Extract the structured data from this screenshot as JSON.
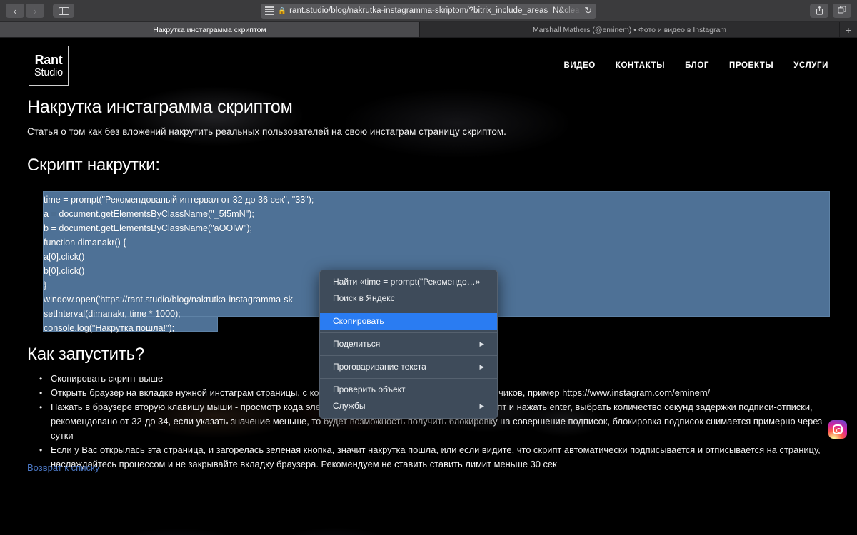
{
  "browser": {
    "back_label": "‹",
    "forward_label": "›",
    "sidebar_label": "sidebar-toggle",
    "url": "rant.studio/blog/nakrutka-instagramma-skriptom/?bitrix_include_areas=N&clea",
    "lock_glyph": "🔒",
    "reload_glyph": "↻",
    "share_glyph": "⤴",
    "tabs_overview_glyph": "⧉",
    "new_tab_label": "+",
    "tabs": [
      {
        "title": "Накрутка инстаграмма скриптом",
        "active": true
      },
      {
        "title": "Marshall Mathers (@eminem) • Фото и видео в Instagram",
        "active": false
      }
    ]
  },
  "site": {
    "logo_line1": "Rant",
    "logo_line2": "Studio",
    "nav": [
      {
        "label": "ВИДЕО"
      },
      {
        "label": "КОНТАКТЫ"
      },
      {
        "label": "БЛОГ"
      },
      {
        "label": "ПРОЕКТЫ"
      },
      {
        "label": "УСЛУГИ"
      }
    ]
  },
  "article": {
    "title": "Накрутка инстаграмма скриптом",
    "lede": "Статья о том как без вложений накрутить реальных пользователей на свою инстаграм страницу скриптом.",
    "script_heading": "Скрипт накрутки:",
    "code": "time = prompt(\"Рекомендованый интервал от 32 до 36 сек\", \"33\");\na = document.getElementsByClassName(\"_5f5mN\");\nb = document.getElementsByClassName(\"aOOlW\");\nfunction dimanakr() {\na[0].click()\nb[0].click()\n}\nwindow.open('https://rant.studio/blog/nakrutka-instagramma-sk\nsetInterval(dimanakr, time * 1000);\nconsole.log(\"Накрутка пошла!\");",
    "how_heading": "Как запустить?",
    "steps": [
      "Скопировать скрипт выше",
      "Открыть браузер на вкладке нужной инстаграм страницы, с которой будет происходить накрутка подписчиков, пример https://www.instagram.com/eminem/",
      "Нажать в браузере вторую клавишу мыши - просмотр кода элемента - консоль: в консоле вставить скрипт и нажать enter, выбрать количество секунд задержки подписи-отписки, рекомендовано от 32-до 34, если указать значение меньше, то будет возможность получить блокировку на совершение подписок, блокировка подписок снимается примерно через сутки",
      "Если у Вас открылась эта страница, и загорелась зеленая кнопка, значит накрутка пошла, или если видите, что скрипт автоматически подписывается и отписывается на страницу, наслаждайтесь процессом и не закрывайте вкладку браузера.\nРекомендуем не ставить ставить лимит меньше 30 сек"
    ],
    "back_link": "Возврат к списку"
  },
  "context_menu": {
    "items": [
      {
        "label": "Найти «time = prompt(\"Рекомендо…»",
        "submenu": false,
        "highlighted": false
      },
      {
        "label": "Поиск в Яндекс",
        "submenu": false,
        "highlighted": false
      },
      {
        "label": "Скопировать",
        "submenu": false,
        "highlighted": true
      },
      {
        "label": "Поделиться",
        "submenu": true,
        "highlighted": false
      },
      {
        "label": "Проговаривание текста",
        "submenu": true,
        "highlighted": false
      },
      {
        "label": "Проверить объект",
        "submenu": false,
        "highlighted": false
      },
      {
        "label": "Службы",
        "submenu": true,
        "highlighted": false
      }
    ],
    "submenu_arrow": "▶"
  },
  "colors": {
    "selection": "#4e7196",
    "menu_bg": "#3e4b5a",
    "menu_highlight": "#2a7cf2",
    "link": "#4b77c4"
  },
  "icons": {
    "instagram": "instagram-icon"
  }
}
